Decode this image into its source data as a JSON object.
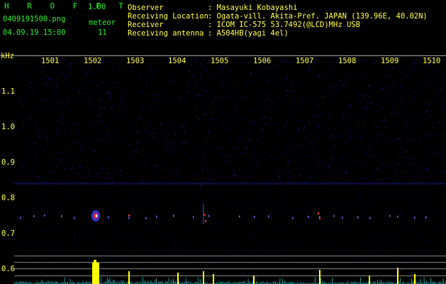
{
  "app": {
    "title": "H R O F F T",
    "version": "1.00"
  },
  "file": {
    "name": "0409191500.png",
    "datetime": "04.09.19 15:00"
  },
  "meteor": {
    "label": "meteor",
    "count": "11"
  },
  "info": {
    "rows": [
      {
        "key": "Observer",
        "value": ": Masayuki Kobayashi"
      },
      {
        "key": "Receiving Location",
        "value": ": Ogata-vill. Akita-Pref. JAPAN (139.96E, 40.02N)"
      },
      {
        "key": "Receiver",
        "value": ": ICOM IC-575 53.7492(@LCD)MHz USB"
      },
      {
        "key": "Receiving antenna",
        "value": ": A504HB(yagi 4el)"
      }
    ]
  },
  "axes": {
    "y_unit": "kHz",
    "x_ticks": [
      "1501",
      "1502",
      "1503",
      "1504",
      "1505",
      "1506",
      "1507",
      "1508",
      "1509",
      "1510"
    ],
    "y_ticks": [
      "1.1",
      "1.0",
      "0.9",
      "0.8",
      "0.7",
      "0.6"
    ]
  },
  "colors": {
    "label": "#2ee82e",
    "ylabel": "#ffff4a",
    "grid": "#8a8a8a",
    "strong": "#ffff00"
  }
}
